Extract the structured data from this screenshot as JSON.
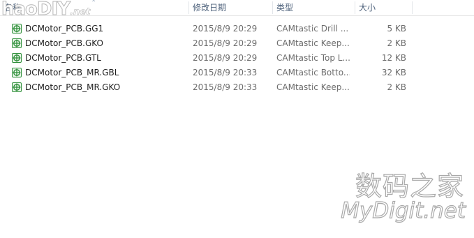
{
  "columns": {
    "name": "名称",
    "date": "修改日期",
    "type": "类型",
    "size": "大小"
  },
  "files": [
    {
      "name": "DCMotor_PCB.GG1",
      "date": "2015/8/9 20:29",
      "type": "CAMtastic Drill ...",
      "size": "5 KB"
    },
    {
      "name": "DCMotor_PCB.GKO",
      "date": "2015/8/9 20:29",
      "type": "CAMtastic Keep...",
      "size": "2 KB"
    },
    {
      "name": "DCMotor_PCB.GTL",
      "date": "2015/8/9 20:29",
      "type": "CAMtastic Top L...",
      "size": "12 KB"
    },
    {
      "name": "DCMotor_PCB_MR.GBL",
      "date": "2015/8/9 20:33",
      "type": "CAMtastic Botto...",
      "size": "32 KB"
    },
    {
      "name": "DCMotor_PCB_MR.GKO",
      "date": "2015/8/9 20:33",
      "type": "CAMtastic Keep...",
      "size": "2 KB"
    }
  ],
  "icons": {
    "file": "camtastic-file-icon",
    "icon_color": "#2f8f3a"
  },
  "watermarks": {
    "top_left": "haoDIY",
    "top_left_suffix": ".net",
    "bottom_right_cn": "数码之家",
    "bottom_right_en": "MyDigit.net"
  }
}
